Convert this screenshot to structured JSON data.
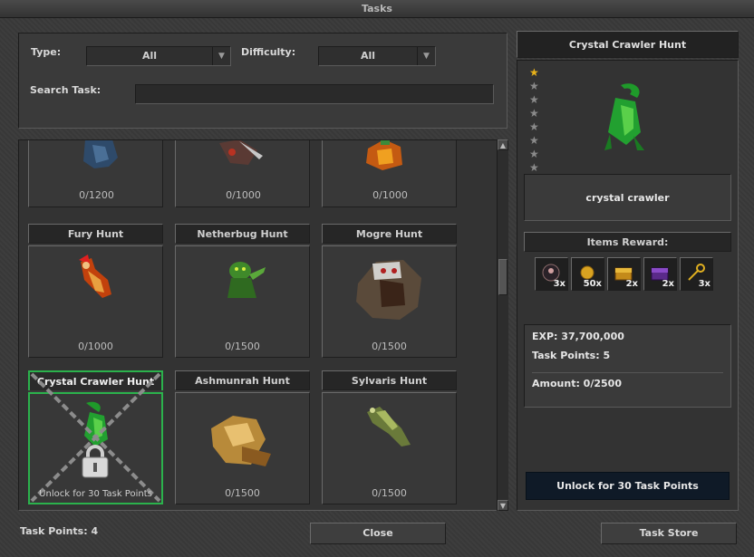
{
  "window": {
    "title": "Tasks"
  },
  "filters": {
    "type_label": "Type:",
    "type_value": "All",
    "difficulty_label": "Difficulty:",
    "difficulty_value": "All",
    "search_label": "Search Task:",
    "search_value": ""
  },
  "partial_row": [
    {
      "progress": "0/1200"
    },
    {
      "progress": "0/1000"
    },
    {
      "progress": "0/1000"
    }
  ],
  "tasks": [
    {
      "name": "Fury Hunt",
      "progress": "0/1000",
      "icon": "fury-icon"
    },
    {
      "name": "Netherbug Hunt",
      "progress": "0/1500",
      "icon": "netherbug-icon"
    },
    {
      "name": "Mogre Hunt",
      "progress": "0/1500",
      "icon": "mogre-icon"
    },
    {
      "name": "Crystal Crawler Hunt",
      "progress": "Unlock for 30 Task Points",
      "icon": "crystal-crawler-icon",
      "locked": true
    },
    {
      "name": "Ashmunrah Hunt",
      "progress": "0/1500",
      "icon": "ashmunrah-icon"
    },
    {
      "name": "Sylvaris Hunt",
      "progress": "0/1500",
      "icon": "sylvaris-icon"
    }
  ],
  "detail": {
    "title": "Crystal Crawler Hunt",
    "difficulty_stars": 1,
    "difficulty_max": 8,
    "creature": "crystal crawler",
    "rewards_title": "Items Reward:",
    "rewards": [
      {
        "icon": "outfit-icon",
        "count": "3x"
      },
      {
        "icon": "gold-coin-icon",
        "count": "50x"
      },
      {
        "icon": "gold-chest-icon",
        "count": "2x"
      },
      {
        "icon": "purple-chest-icon",
        "count": "2x"
      },
      {
        "icon": "golden-key-icon",
        "count": "3x"
      }
    ],
    "exp": "EXP: 37,700,000",
    "task_points": "Task Points: 5",
    "amount": "Amount: 0/2500",
    "unlock_label": "Unlock for 30 Task Points"
  },
  "footer": {
    "task_points": "Task Points: 4",
    "close_label": "Close",
    "store_label": "Task Store"
  },
  "colors": {
    "selected_border": "#2bb24c",
    "star_on": "#e8b21a",
    "unlock_bg": "#0f1a27"
  }
}
